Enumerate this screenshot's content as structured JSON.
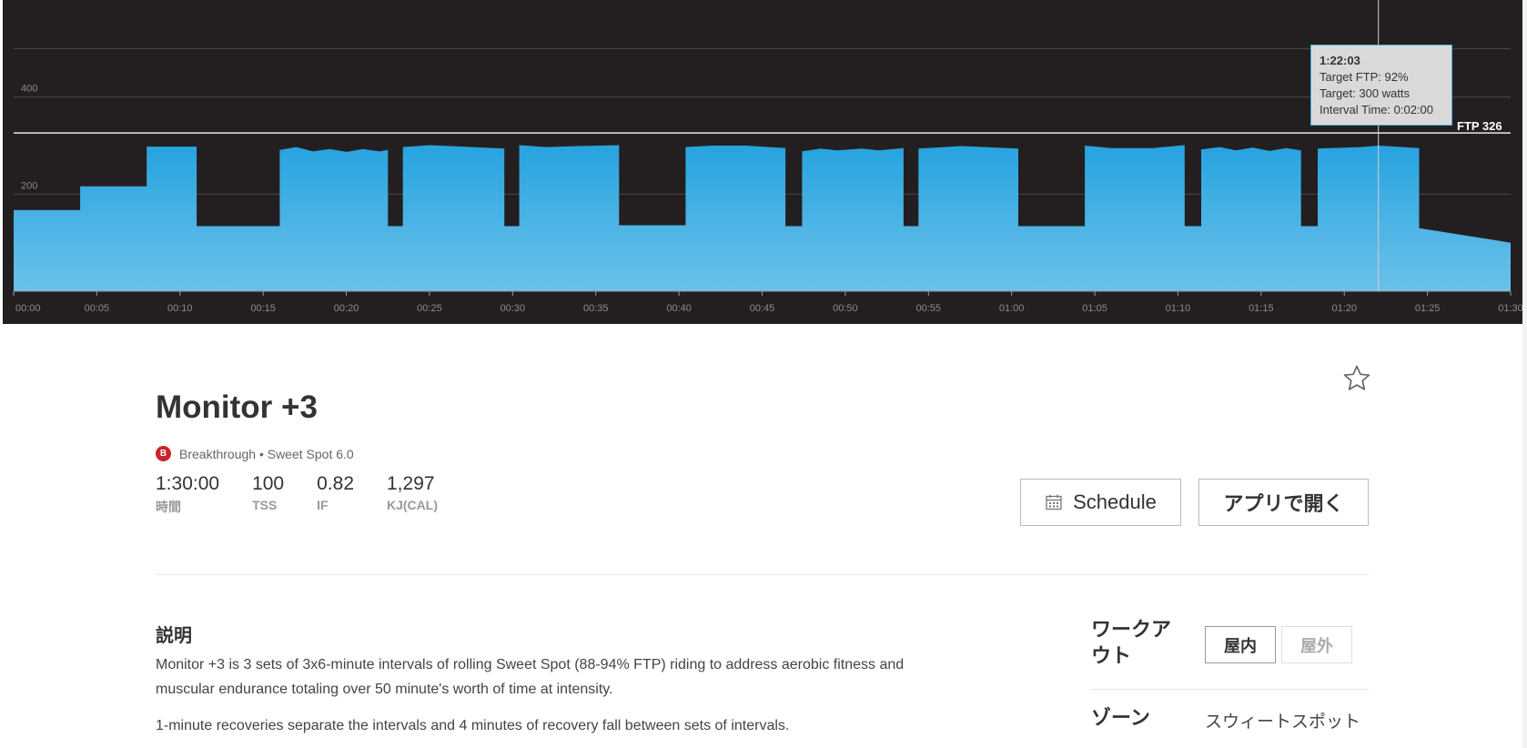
{
  "chart_data": {
    "type": "area",
    "x_unit": "minutes",
    "xlim": [
      0,
      90
    ],
    "ylim": [
      0,
      600
    ],
    "yticks": [
      {
        "value": 200,
        "label": "200"
      },
      {
        "value": 400,
        "label": "400"
      }
    ],
    "xticks": [
      {
        "value": 0,
        "label": "00:00"
      },
      {
        "value": 5,
        "label": "00:05"
      },
      {
        "value": 10,
        "label": "00:10"
      },
      {
        "value": 15,
        "label": "00:15"
      },
      {
        "value": 20,
        "label": "00:20"
      },
      {
        "value": 25,
        "label": "00:25"
      },
      {
        "value": 30,
        "label": "00:30"
      },
      {
        "value": 35,
        "label": "00:35"
      },
      {
        "value": 40,
        "label": "00:40"
      },
      {
        "value": 45,
        "label": "00:45"
      },
      {
        "value": 50,
        "label": "00:50"
      },
      {
        "value": 55,
        "label": "00:55"
      },
      {
        "value": 60,
        "label": "01:00"
      },
      {
        "value": 65,
        "label": "01:05"
      },
      {
        "value": 70,
        "label": "01:10"
      },
      {
        "value": 75,
        "label": "01:15"
      },
      {
        "value": 80,
        "label": "01:20"
      },
      {
        "value": 85,
        "label": "01:25"
      },
      {
        "value": 90,
        "label": "01:30"
      }
    ],
    "ftp_line": {
      "value": 326,
      "label": "FTP 326"
    },
    "cursor_x": 82.05,
    "fill_color": "#2ea6e0",
    "background": "#231f20",
    "points": [
      [
        0,
        167
      ],
      [
        4,
        167
      ],
      [
        4,
        216
      ],
      [
        8,
        216
      ],
      [
        8,
        298
      ],
      [
        11,
        298
      ],
      [
        11,
        134
      ],
      [
        16,
        134
      ],
      [
        16,
        291
      ],
      [
        17,
        297
      ],
      [
        18,
        288
      ],
      [
        19,
        293
      ],
      [
        20,
        287
      ],
      [
        21,
        293
      ],
      [
        22,
        288
      ],
      [
        22.5,
        291
      ],
      [
        22.5,
        134
      ],
      [
        23.4,
        134
      ],
      [
        23.4,
        297
      ],
      [
        25,
        301
      ],
      [
        27,
        298
      ],
      [
        29.5,
        294
      ],
      [
        29.5,
        134
      ],
      [
        30.4,
        134
      ],
      [
        30.4,
        301
      ],
      [
        32,
        297
      ],
      [
        34,
        299
      ],
      [
        36.4,
        301
      ],
      [
        36.4,
        136
      ],
      [
        40.4,
        136
      ],
      [
        40.4,
        297
      ],
      [
        42,
        300
      ],
      [
        44,
        300
      ],
      [
        46.4,
        295
      ],
      [
        46.4,
        134
      ],
      [
        47.4,
        134
      ],
      [
        47.4,
        288
      ],
      [
        48.5,
        294
      ],
      [
        49.5,
        290
      ],
      [
        51,
        294
      ],
      [
        52,
        290
      ],
      [
        53.5,
        295
      ],
      [
        53.5,
        134
      ],
      [
        54.4,
        134
      ],
      [
        54.4,
        294
      ],
      [
        57,
        299
      ],
      [
        60.4,
        294
      ],
      [
        60.4,
        134
      ],
      [
        64.4,
        134
      ],
      [
        64.4,
        300
      ],
      [
        66,
        295
      ],
      [
        68.5,
        295
      ],
      [
        70.4,
        301
      ],
      [
        70.4,
        134
      ],
      [
        71.4,
        134
      ],
      [
        71.4,
        292
      ],
      [
        72.5,
        297
      ],
      [
        73.5,
        290
      ],
      [
        74.5,
        296
      ],
      [
        75.5,
        289
      ],
      [
        76.5,
        295
      ],
      [
        77.4,
        290
      ],
      [
        77.4,
        134
      ],
      [
        78.4,
        134
      ],
      [
        78.4,
        294
      ],
      [
        81,
        297
      ],
      [
        82.05,
        300
      ],
      [
        84.5,
        295
      ],
      [
        84.5,
        130
      ],
      [
        90,
        100
      ],
      [
        90,
        0
      ],
      [
        0,
        0
      ]
    ]
  },
  "tooltip": {
    "time": "1:22:03",
    "target_ftp": "Target FTP: 92%",
    "target_watts": "Target: 300 watts",
    "interval_time": "Interval Time: 0:02:00"
  },
  "workout": {
    "title": "Monitor +3",
    "badge_letter": "B",
    "category": "Breakthrough • Sweet Spot 6.0",
    "stats": [
      {
        "value": "1:30:00",
        "label": "時間"
      },
      {
        "value": "100",
        "label": "TSS"
      },
      {
        "value": "0.82",
        "label": "IF"
      },
      {
        "value": "1,297",
        "label": "KJ(CAL)"
      }
    ],
    "schedule_label": "Schedule",
    "open_app_label": "アプリで開く",
    "star_icon": "star-outline-icon",
    "calendar_icon": "calendar-icon"
  },
  "description": {
    "heading": "説明",
    "para1": "Monitor +3 is 3 sets of 3x6-minute intervals of rolling Sweet Spot (88-94% FTP) riding to address aerobic fitness and muscular endurance totaling over 50 minute's worth of time at intensity.",
    "para2": "1-minute recoveries separate the intervals and 4 minutes of recovery fall between sets of intervals."
  },
  "sidebar": {
    "workout_label": "ワークアウト",
    "indoor_label": "屋内",
    "outdoor_label": "屋外",
    "selected": "屋内",
    "zone_label": "ゾーン",
    "zone_value": "スウィートスポット"
  }
}
